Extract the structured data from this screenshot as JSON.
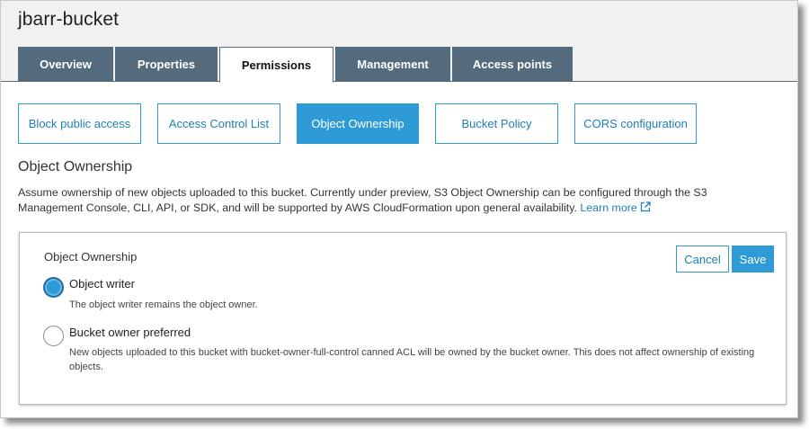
{
  "bucket": {
    "title": "jbarr-bucket"
  },
  "main_tabs": [
    {
      "label": "Overview",
      "active": false
    },
    {
      "label": "Properties",
      "active": false
    },
    {
      "label": "Permissions",
      "active": true
    },
    {
      "label": "Management",
      "active": false
    },
    {
      "label": "Access points",
      "active": false
    }
  ],
  "sub_tabs": [
    {
      "label": "Block public access",
      "active": false
    },
    {
      "label": "Access Control List",
      "active": false
    },
    {
      "label": "Object Ownership",
      "active": true
    },
    {
      "label": "Bucket Policy",
      "active": false
    },
    {
      "label": "CORS configuration",
      "active": false
    }
  ],
  "section": {
    "heading": "Object Ownership",
    "description": "Assume ownership of new objects uploaded to this bucket. Currently under preview, S3 Object Ownership can be configured through the S3 Management Console, CLI, API, or SDK, and will be supported by AWS CloudFormation upon general availability.",
    "learn_more": "Learn more",
    "learn_more_icon": "external-link-icon"
  },
  "card": {
    "title": "Object Ownership",
    "cancel_label": "Cancel",
    "save_label": "Save",
    "options": [
      {
        "label": "Object writer",
        "help": "The object writer remains the object owner.",
        "checked": true
      },
      {
        "label": "Bucket owner preferred",
        "help": "New objects uploaded to this bucket with bucket-owner-full-control canned ACL will be owned by the bucket owner. This does not affect ownership of existing objects.",
        "checked": false
      }
    ]
  },
  "colors": {
    "accent": "#2f9bd6",
    "tab_bg": "#546b7d",
    "header_bg": "#f1f1f1"
  }
}
